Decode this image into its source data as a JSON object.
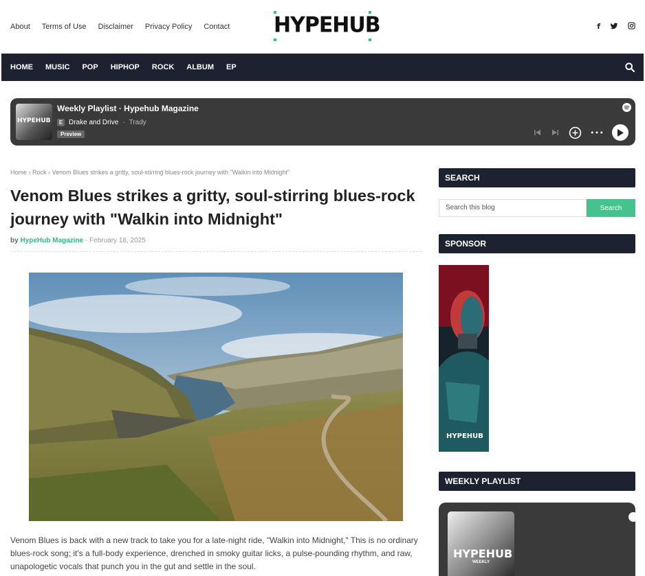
{
  "header": {
    "links": [
      "About",
      "Terms of Use",
      "Disclaimer",
      "Privacy Policy",
      "Contact"
    ],
    "logo": "HYPEHUB",
    "social_icons": [
      "facebook-icon",
      "twitter-icon",
      "instagram-icon"
    ]
  },
  "nav": {
    "items": [
      "HOME",
      "MUSIC",
      "POP",
      "HIPHOP",
      "ROCK",
      "ALBUM",
      "EP"
    ],
    "search_icon": "search-icon"
  },
  "player": {
    "cover_text": "HYPEHUB",
    "title": "Weekly Playlist · Hypehub Magazine",
    "explicit": "E",
    "track": "Drake and Drive",
    "separator": "·",
    "artist": "Trady",
    "preview": "Preview",
    "icons": [
      "spotify-icon",
      "previous-icon",
      "next-icon",
      "add-icon",
      "more-icon",
      "play-icon"
    ]
  },
  "article": {
    "breadcrumb": [
      "Home",
      "Rock",
      "Venom Blues strikes a gritty, soul-stirring blues-rock journey with \"Walkin into Midnight\""
    ],
    "title": "Venom Blues strikes a gritty, soul-stirring blues-rock journey with \"Walkin into Midnight\"",
    "by_label": "by",
    "author": "HypeHub Magazine",
    "date_sep": "-",
    "date": "February 18, 2025",
    "body": "Venom Blues is back with a new track to take you  for a late-night ride, \"Walkin into Midnight,\" This is no ordinary blues-rock song; it's a full-body experience, drenched in smoky guitar licks, a pulse-pounding rhythm, and raw, unapologetic vocals that punch you  in the gut and settle in the soul."
  },
  "sidebar": {
    "search_heading": "SEARCH",
    "search_placeholder": "Search this blog",
    "search_button": "Search",
    "sponsor_heading": "SPONSOR",
    "sponsor_text": "HYPEHUB",
    "weekly_heading": "WEEKLY PLAYLIST",
    "weekly_cover_text": "HYPEHUB",
    "weekly_cover_sub": "WEEKLY"
  },
  "colors": {
    "nav_bg": "#1c2230",
    "accent": "#2db981",
    "player_bg": "#3a3a3a"
  }
}
